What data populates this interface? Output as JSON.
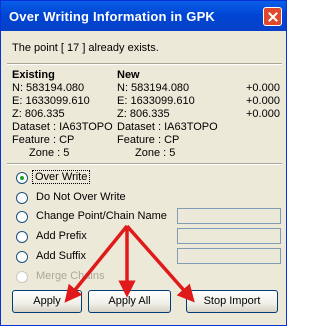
{
  "window": {
    "title": "Over Writing Information in GPK"
  },
  "message": "The point [ 17 ] already exists.",
  "existing": {
    "heading": "Existing",
    "n": "N: 583194.080",
    "e": "E: 1633099.610",
    "z": "Z: 806.335",
    "dataset": "Dataset : IA63TOPO",
    "feature": "Feature : CP",
    "zone": "Zone : 5"
  },
  "new": {
    "heading": "New",
    "n": "N: 583194.080",
    "e": "E: 1633099.610",
    "z": "Z: 806.335",
    "dataset": "Dataset : IA63TOPO",
    "feature": "Feature : CP",
    "zone": "Zone : 5",
    "n_diff": "+0.000",
    "e_diff": "+0.000",
    "z_diff": "+0.000"
  },
  "options": [
    {
      "label": "Over Write",
      "selected": true
    },
    {
      "label": "Do Not Over Write"
    },
    {
      "label": "Change Point/Chain Name"
    },
    {
      "label": "Add Prefix"
    },
    {
      "label": "Add Suffix"
    },
    {
      "label": "Merge Chains",
      "disabled": true
    }
  ],
  "buttons": {
    "apply": "Apply",
    "apply_all": "Apply All",
    "stop_import": "Stop Import"
  },
  "colors": {
    "title_bar": "#0a5ee8",
    "arrow": "#e0191b",
    "dialog_bg": "#ece9d8"
  }
}
